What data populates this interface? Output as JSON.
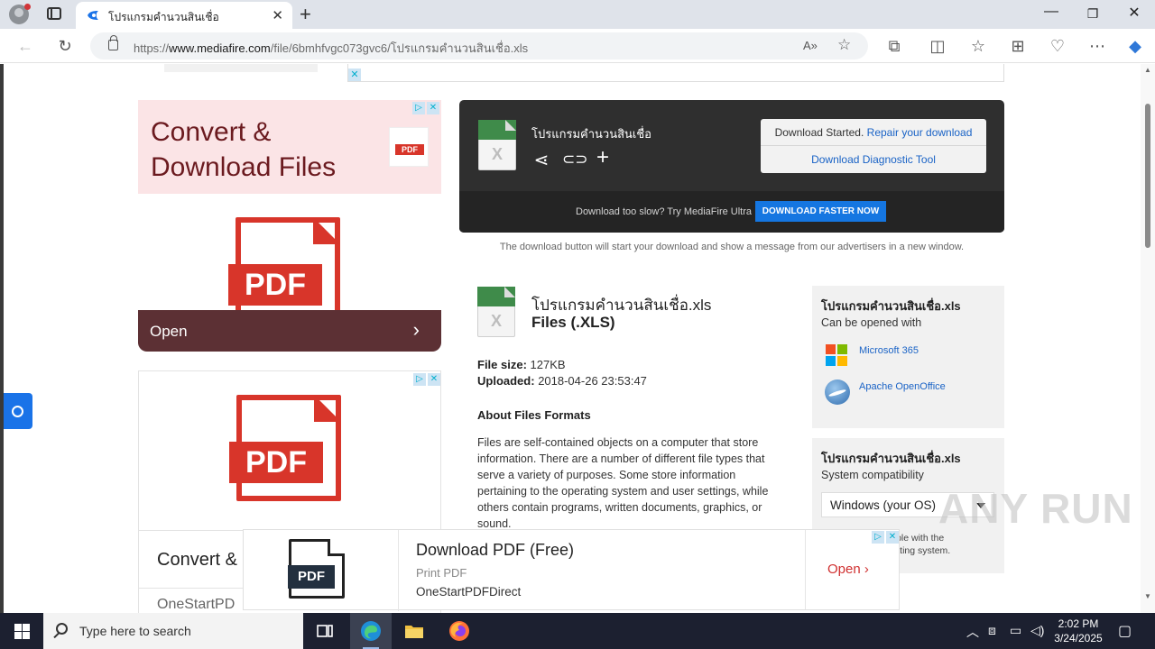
{
  "browser": {
    "tab_title": "โปรแกรมคำนวนสินเชื่อ",
    "url_prefix": "https://",
    "url_domain": "www.mediafire.com",
    "url_path": "/file/6bmhfvgc073gvc6/โปรแกรมคำนวนสินเชื่อ.xls"
  },
  "left_ad_top": {
    "headline": "Convert &\nDownload Files",
    "pdf_label": "PDF",
    "open_label": "Open"
  },
  "left_ad_bottom": {
    "pdf_label": "PDF",
    "title": "Convert &",
    "sub": "OneStartPD"
  },
  "download_card": {
    "file_name": "โปรแกรมคำนวนสินเชื่อ",
    "status_prefix": "Download Started.",
    "status_link": "Repair your download",
    "diagnostic_link": "Download Diagnostic Tool",
    "slow_text": "Download too slow? Try MediaFire Ultra",
    "faster_button": "DOWNLOAD FASTER NOW",
    "note": "The download button will start your download and show a message from our advertisers in a new window."
  },
  "file_details": {
    "name": "โปรแกรมคำนวนสินเชื่อ.xls",
    "type": "Files (.XLS)",
    "size_label": "File size:",
    "size_value": "127KB",
    "uploaded_label": "Uploaded:",
    "uploaded_value": "2018-04-26 23:53:47",
    "about_heading": "About Files Formats",
    "about_text": "Files are self-contained objects on a computer that store information. There are a number of different file types that serve a variety of purposes. Some store information pertaining to the operating system and user settings, while others contain programs, written documents, graphics, or sound."
  },
  "open_with_panel": {
    "title": "โปรแกรมคำนวนสินเชื่อ.xls",
    "subtitle": "Can be opened with",
    "apps": [
      "Microsoft 365",
      "Apache OpenOffice"
    ]
  },
  "compat_panel": {
    "title": "โปรแกรมคำนวนสินเชื่อ.xls",
    "subtitle": "System compatibility",
    "selected_os": "Windows (your OS)",
    "compat_text_1": "atible with the",
    "compat_text_2": "erating system."
  },
  "banner_ad": {
    "pdf_label": "PDF",
    "title": "Download PDF (Free)",
    "sub1": "Print PDF",
    "sub2": "OneStartPDFDirect",
    "open_label": "Open"
  },
  "watermark": "ANY RUN",
  "taskbar": {
    "search_placeholder": "Type here to search",
    "time": "2:02 PM",
    "date": "3/24/2025"
  },
  "colors": {
    "accent_blue": "#1576e1",
    "link_blue": "#1a63c6",
    "pdf_red": "#d8352a",
    "xls_green": "#3f8b4a"
  }
}
